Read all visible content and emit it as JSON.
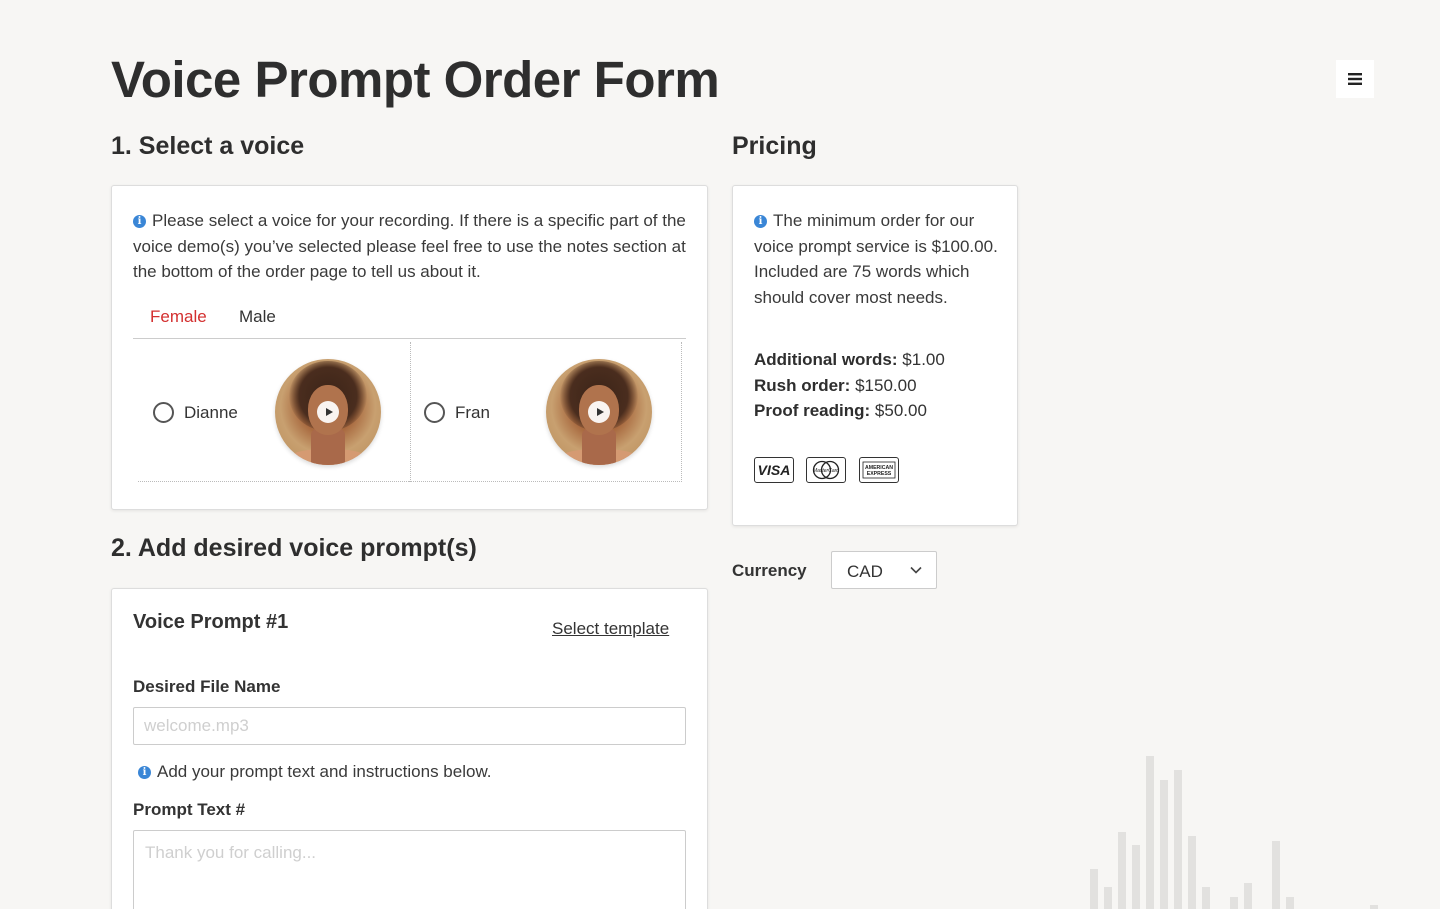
{
  "page": {
    "title": "Voice Prompt Order Form"
  },
  "menu": {
    "icon": "hamburger-menu-icon"
  },
  "section1": {
    "title": "1. Select a voice",
    "info": "Please select a voice for your recording. If there is a specific part of the voice demo(s) you’ve selected please feel free to use the notes section at the bottom of the order page to tell us about it.",
    "tabs": [
      {
        "label": "Female",
        "active": true
      },
      {
        "label": "Male",
        "active": false
      }
    ],
    "voices": [
      {
        "name": "Dianne",
        "selected": false,
        "icon": "play-icon"
      },
      {
        "name": "Fran",
        "selected": false,
        "icon": "play-icon"
      }
    ]
  },
  "pricing": {
    "title": "Pricing",
    "info": "The minimum order for our voice prompt service is $100.00. Included are 75 words which should cover most needs.",
    "lines": [
      {
        "label": "Additional words:",
        "value": "$1.00"
      },
      {
        "label": "Rush order:",
        "value": "$150.00"
      },
      {
        "label": "Proof reading:",
        "value": "$50.00"
      }
    ],
    "payment_methods": [
      "visa-icon",
      "mastercard-icon",
      "american-express-icon"
    ],
    "visa_text": "VISA",
    "mastercard_text": "MasterCard",
    "amex_text": [
      "AMERICAN",
      "EXPRESS"
    ]
  },
  "currency": {
    "label": "Currency",
    "value": "CAD"
  },
  "section2": {
    "title": "2. Add desired voice prompt(s)",
    "prompt_title": "Voice Prompt #1",
    "template_link": "Select template",
    "file_name_label": "Desired File Name",
    "file_name_placeholder": "welcome.mp3",
    "file_name_value": "",
    "info": "Add your prompt text and instructions below.",
    "prompt_text_label": "Prompt Text #",
    "prompt_text_placeholder": "Thank you for calling...",
    "prompt_text_value": ""
  },
  "colors": {
    "accent": "#d32f2f",
    "info": "#3a86d6",
    "background": "#f7f6f4"
  }
}
